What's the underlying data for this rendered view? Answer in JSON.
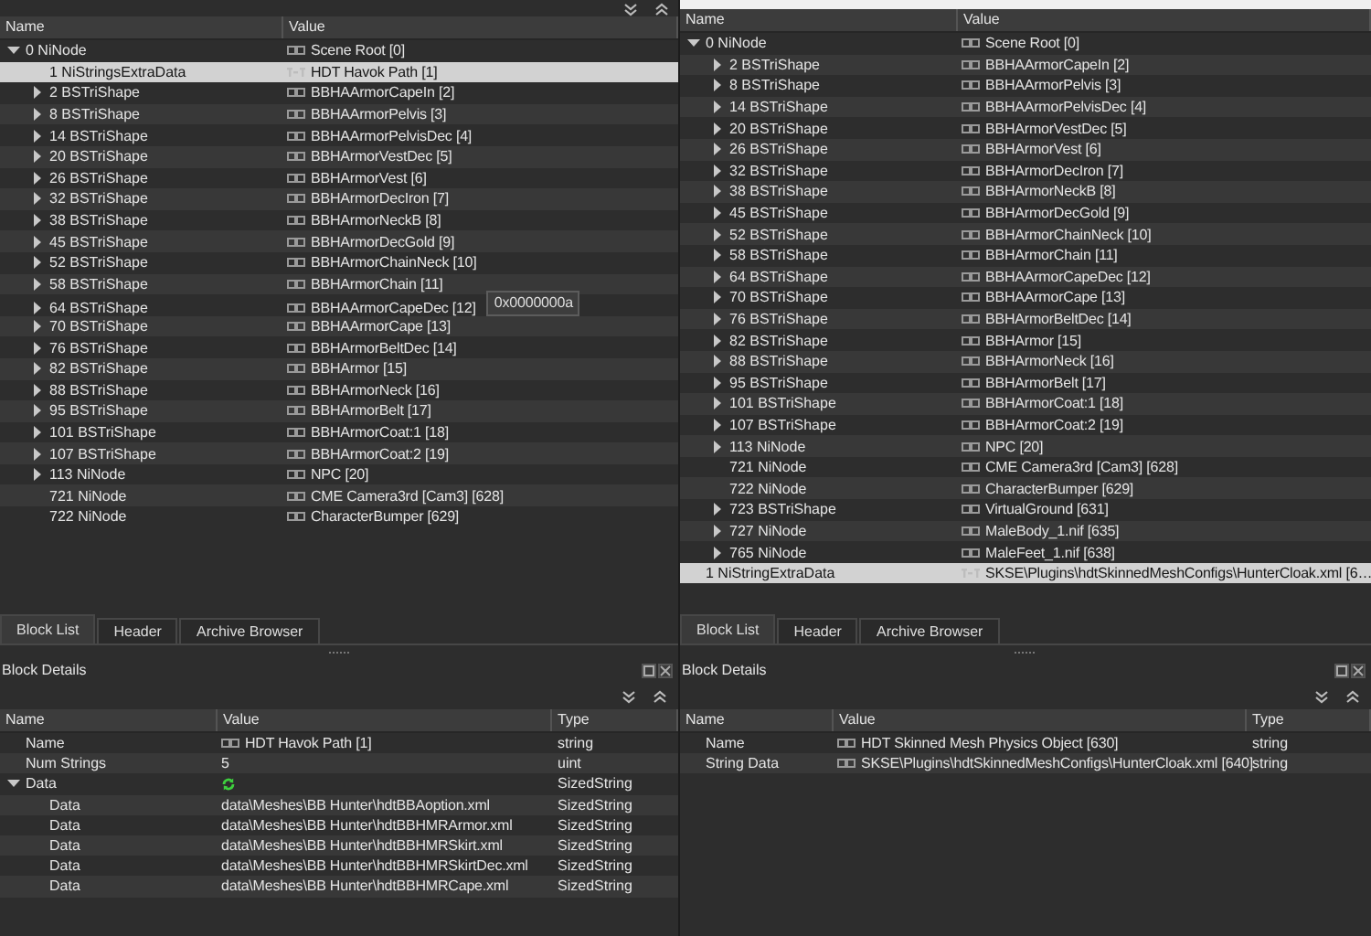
{
  "panes": [
    {
      "block_list": {
        "columns": [
          "Name",
          "Value"
        ],
        "rows": [
          {
            "name": "0 NiNode",
            "value": "Scene Root [0]",
            "kind": "link",
            "expanded": true,
            "selected": false,
            "children": [
              {
                "name": "1 NiStringsExtraData",
                "value": "HDT Havok Path [1]",
                "kind": "string",
                "selected": true
              },
              {
                "name": "2 BSTriShape",
                "value": "BBHAArmorCapeIn [2]",
                "kind": "link",
                "expanded": false,
                "selected": false
              },
              {
                "name": "8 BSTriShape",
                "value": "BBHAArmorPelvis [3]",
                "kind": "link",
                "expanded": false,
                "selected": false
              },
              {
                "name": "14 BSTriShape",
                "value": "BBHAArmorPelvisDec [4]",
                "kind": "link",
                "expanded": false,
                "selected": false
              },
              {
                "name": "20 BSTriShape",
                "value": "BBHArmorVestDec [5]",
                "kind": "link",
                "expanded": false,
                "selected": false
              },
              {
                "name": "26 BSTriShape",
                "value": "BBHArmorVest [6]",
                "kind": "link",
                "expanded": false,
                "selected": false
              },
              {
                "name": "32 BSTriShape",
                "value": "BBHArmorDecIron [7]",
                "kind": "link",
                "expanded": false,
                "selected": false
              },
              {
                "name": "38 BSTriShape",
                "value": "BBHArmorNeckB [8]",
                "kind": "link",
                "expanded": false,
                "selected": false
              },
              {
                "name": "45 BSTriShape",
                "value": "BBHArmorDecGold [9]",
                "kind": "link",
                "expanded": false,
                "selected": false
              },
              {
                "name": "52 BSTriShape",
                "value": "BBHArmorChainNeck [10]",
                "kind": "link",
                "expanded": false,
                "selected": false
              },
              {
                "name": "58 BSTriShape",
                "value": "BBHArmorChain [11]",
                "kind": "link",
                "expanded": false,
                "selected": false
              },
              {
                "name": "64 BSTriShape",
                "value": "BBHAArmorCapeDec [12]",
                "kind": "link",
                "expanded": false,
                "selected": false,
                "tooltip": "0x0000000a"
              },
              {
                "name": "70 BSTriShape",
                "value": "BBHAArmorCape [13]",
                "kind": "link",
                "expanded": false,
                "selected": false
              },
              {
                "name": "76 BSTriShape",
                "value": "BBHArmorBeltDec [14]",
                "kind": "link",
                "expanded": false,
                "selected": false
              },
              {
                "name": "82 BSTriShape",
                "value": "BBHArmor [15]",
                "kind": "link",
                "expanded": false,
                "selected": false
              },
              {
                "name": "88 BSTriShape",
                "value": "BBHArmorNeck [16]",
                "kind": "link",
                "expanded": false,
                "selected": false
              },
              {
                "name": "95 BSTriShape",
                "value": "BBHArmorBelt [17]",
                "kind": "link",
                "expanded": false,
                "selected": false
              },
              {
                "name": "101 BSTriShape",
                "value": "BBHArmorCoat:1 [18]",
                "kind": "link",
                "expanded": false,
                "selected": false
              },
              {
                "name": "107 BSTriShape",
                "value": "BBHArmorCoat:2 [19]",
                "kind": "link",
                "expanded": false,
                "selected": false
              },
              {
                "name": "113 NiNode",
                "value": "NPC [20]",
                "kind": "link",
                "expanded": false,
                "selected": false
              },
              {
                "name": "721 NiNode",
                "value": "CME Camera3rd [Cam3] [628]",
                "kind": "link",
                "selected": false
              },
              {
                "name": "722 NiNode",
                "value": "CharacterBumper [629]",
                "kind": "link",
                "selected": false
              }
            ]
          }
        ]
      },
      "tabs": [
        {
          "label": "Block List",
          "selected": true
        },
        {
          "label": "Header",
          "selected": false
        },
        {
          "label": "Archive Browser",
          "selected": false
        }
      ],
      "details_title": "Block Details",
      "block_details": {
        "columns": [
          "Name",
          "Value",
          "Type"
        ],
        "rows": [
          {
            "name": "Name",
            "value": "HDT Havok Path [1]",
            "kind": "link",
            "type": "string"
          },
          {
            "name": "Num Strings",
            "value": "5",
            "type": "uint"
          },
          {
            "name": "Data",
            "kind": "array",
            "type": "SizedString",
            "expanded": true,
            "children": [
              {
                "name": "Data",
                "value": "data\\Meshes\\BB Hunter\\hdtBBAoption.xml",
                "type": "SizedString"
              },
              {
                "name": "Data",
                "value": "data\\Meshes\\BB Hunter\\hdtBBHMRArmor.xml",
                "type": "SizedString"
              },
              {
                "name": "Data",
                "value": "data\\Meshes\\BB Hunter\\hdtBBHMRSkirt.xml",
                "type": "SizedString"
              },
              {
                "name": "Data",
                "value": "data\\Meshes\\BB Hunter\\hdtBBHMRSkirtDec.xml",
                "type": "SizedString"
              },
              {
                "name": "Data",
                "value": "data\\Meshes\\BB Hunter\\hdtBBHMRCape.xml",
                "type": "SizedString"
              }
            ]
          }
        ]
      }
    },
    {
      "block_list": {
        "columns": [
          "Name",
          "Value"
        ],
        "rows": [
          {
            "name": "0 NiNode",
            "value": "Scene Root [0]",
            "kind": "link",
            "expanded": true,
            "selected": false,
            "children": [
              {
                "name": "2 BSTriShape",
                "value": "BBHAArmorCapeIn [2]",
                "kind": "link",
                "expanded": false,
                "selected": false
              },
              {
                "name": "8 BSTriShape",
                "value": "BBHAArmorPelvis [3]",
                "kind": "link",
                "expanded": false,
                "selected": false
              },
              {
                "name": "14 BSTriShape",
                "value": "BBHAArmorPelvisDec [4]",
                "kind": "link",
                "expanded": false,
                "selected": false
              },
              {
                "name": "20 BSTriShape",
                "value": "BBHArmorVestDec [5]",
                "kind": "link",
                "expanded": false,
                "selected": false
              },
              {
                "name": "26 BSTriShape",
                "value": "BBHArmorVest [6]",
                "kind": "link",
                "expanded": false,
                "selected": false
              },
              {
                "name": "32 BSTriShape",
                "value": "BBHArmorDecIron [7]",
                "kind": "link",
                "expanded": false,
                "selected": false
              },
              {
                "name": "38 BSTriShape",
                "value": "BBHArmorNeckB [8]",
                "kind": "link",
                "expanded": false,
                "selected": false
              },
              {
                "name": "45 BSTriShape",
                "value": "BBHArmorDecGold [9]",
                "kind": "link",
                "expanded": false,
                "selected": false
              },
              {
                "name": "52 BSTriShape",
                "value": "BBHArmorChainNeck [10]",
                "kind": "link",
                "expanded": false,
                "selected": false
              },
              {
                "name": "58 BSTriShape",
                "value": "BBHArmorChain [11]",
                "kind": "link",
                "expanded": false,
                "selected": false
              },
              {
                "name": "64 BSTriShape",
                "value": "BBHAArmorCapeDec [12]",
                "kind": "link",
                "expanded": false,
                "selected": false
              },
              {
                "name": "70 BSTriShape",
                "value": "BBHAArmorCape [13]",
                "kind": "link",
                "expanded": false,
                "selected": false
              },
              {
                "name": "76 BSTriShape",
                "value": "BBHArmorBeltDec [14]",
                "kind": "link",
                "expanded": false,
                "selected": false
              },
              {
                "name": "82 BSTriShape",
                "value": "BBHArmor [15]",
                "kind": "link",
                "expanded": false,
                "selected": false
              },
              {
                "name": "88 BSTriShape",
                "value": "BBHArmorNeck [16]",
                "kind": "link",
                "expanded": false,
                "selected": false
              },
              {
                "name": "95 BSTriShape",
                "value": "BBHArmorBelt [17]",
                "kind": "link",
                "expanded": false,
                "selected": false
              },
              {
                "name": "101 BSTriShape",
                "value": "BBHArmorCoat:1 [18]",
                "kind": "link",
                "expanded": false,
                "selected": false
              },
              {
                "name": "107 BSTriShape",
                "value": "BBHArmorCoat:2 [19]",
                "kind": "link",
                "expanded": false,
                "selected": false
              },
              {
                "name": "113 NiNode",
                "value": "NPC [20]",
                "kind": "link",
                "expanded": false,
                "selected": false
              },
              {
                "name": "721 NiNode",
                "value": "CME Camera3rd [Cam3] [628]",
                "kind": "link",
                "selected": false
              },
              {
                "name": "722 NiNode",
                "value": "CharacterBumper [629]",
                "kind": "link",
                "selected": false
              },
              {
                "name": "723 BSTriShape",
                "value": "VirtualGround [631]",
                "kind": "link",
                "expanded": false,
                "selected": false
              },
              {
                "name": "727 NiNode",
                "value": "MaleBody_1.nif [635]",
                "kind": "link",
                "expanded": false,
                "selected": false
              },
              {
                "name": "765 NiNode",
                "value": "MaleFeet_1.nif [638]",
                "kind": "link",
                "expanded": false,
                "selected": false
              }
            ]
          },
          {
            "name": "1 NiStringExtraData",
            "value": "SKSE\\Plugins\\hdtSkinnedMeshConfigs\\HunterCloak.xml [6…",
            "kind": "string",
            "selected": true
          }
        ]
      },
      "tabs": [
        {
          "label": "Block List",
          "selected": true
        },
        {
          "label": "Header",
          "selected": false
        },
        {
          "label": "Archive Browser",
          "selected": false
        }
      ],
      "details_title": "Block Details",
      "block_details": {
        "columns": [
          "Name",
          "Value",
          "Type"
        ],
        "rows": [
          {
            "name": "Name",
            "value": "HDT Skinned Mesh Physics Object [630]",
            "kind": "link",
            "type": "string"
          },
          {
            "name": "String Data",
            "value": "SKSE\\Plugins\\hdtSkinnedMeshConfigs\\HunterCloak.xml [640]",
            "kind": "link",
            "type": "string"
          }
        ]
      }
    }
  ]
}
